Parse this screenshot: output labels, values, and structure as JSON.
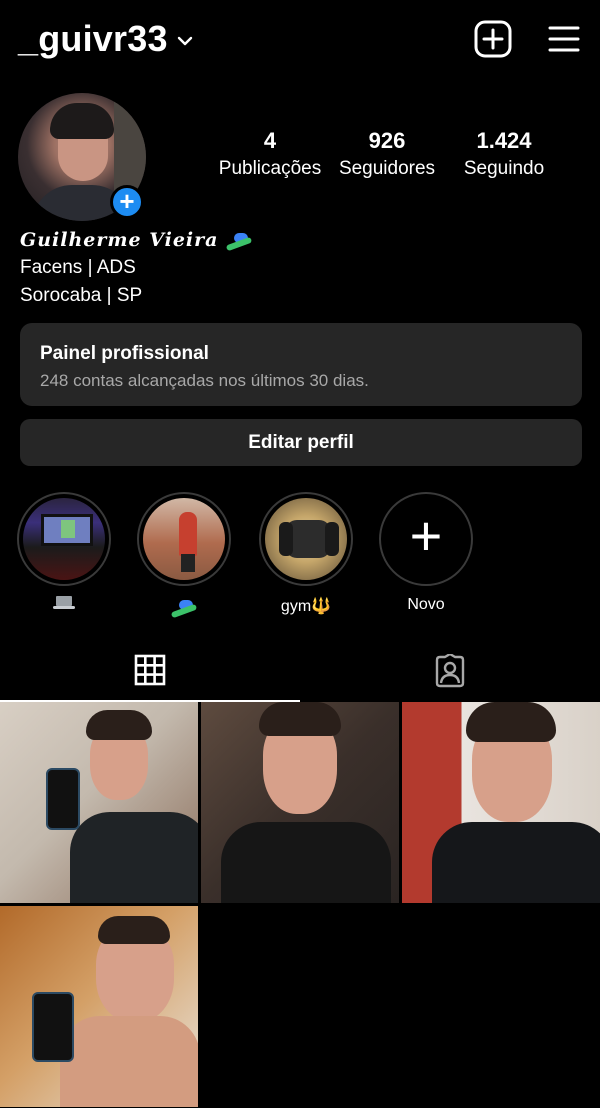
{
  "header": {
    "username": "_guivr33",
    "icons": {
      "switch_account": "chevron-down-icon",
      "create": "plus-square-icon",
      "menu": "hamburger-menu-icon"
    }
  },
  "profile": {
    "stats": [
      {
        "value": "4",
        "label": "Publicações"
      },
      {
        "value": "926",
        "label": "Seguidores"
      },
      {
        "value": "1.424",
        "label": "Seguindo"
      }
    ],
    "add_story_icon": "plus-badge-icon"
  },
  "bio": {
    "name": "Guilherme Vieira",
    "name_emoji": "surfer-emoji-icon",
    "line1": "Facens | ADS",
    "line2": "Sorocaba | SP"
  },
  "dashboard": {
    "title": "Painel profissional",
    "subtitle": "248 contas alcançadas nos últimos 30 dias."
  },
  "edit_profile_label": "Editar perfil",
  "highlights": [
    {
      "label": "",
      "label_icon": "laptop-emoji-icon"
    },
    {
      "label": "",
      "label_icon": "surfer-emoji-icon"
    },
    {
      "label": "gym🔱",
      "label_icon": ""
    },
    {
      "label": "Novo",
      "label_icon": ""
    }
  ],
  "tabs": [
    {
      "name": "posts-grid-tab",
      "icon": "grid-icon",
      "active": true
    },
    {
      "name": "tagged-tab",
      "icon": "tagged-person-icon",
      "active": false
    }
  ],
  "colors": {
    "background": "#000000",
    "card": "#262626",
    "secondary_text": "#a8a8a8",
    "accent_blue": "#1d8cf2"
  }
}
